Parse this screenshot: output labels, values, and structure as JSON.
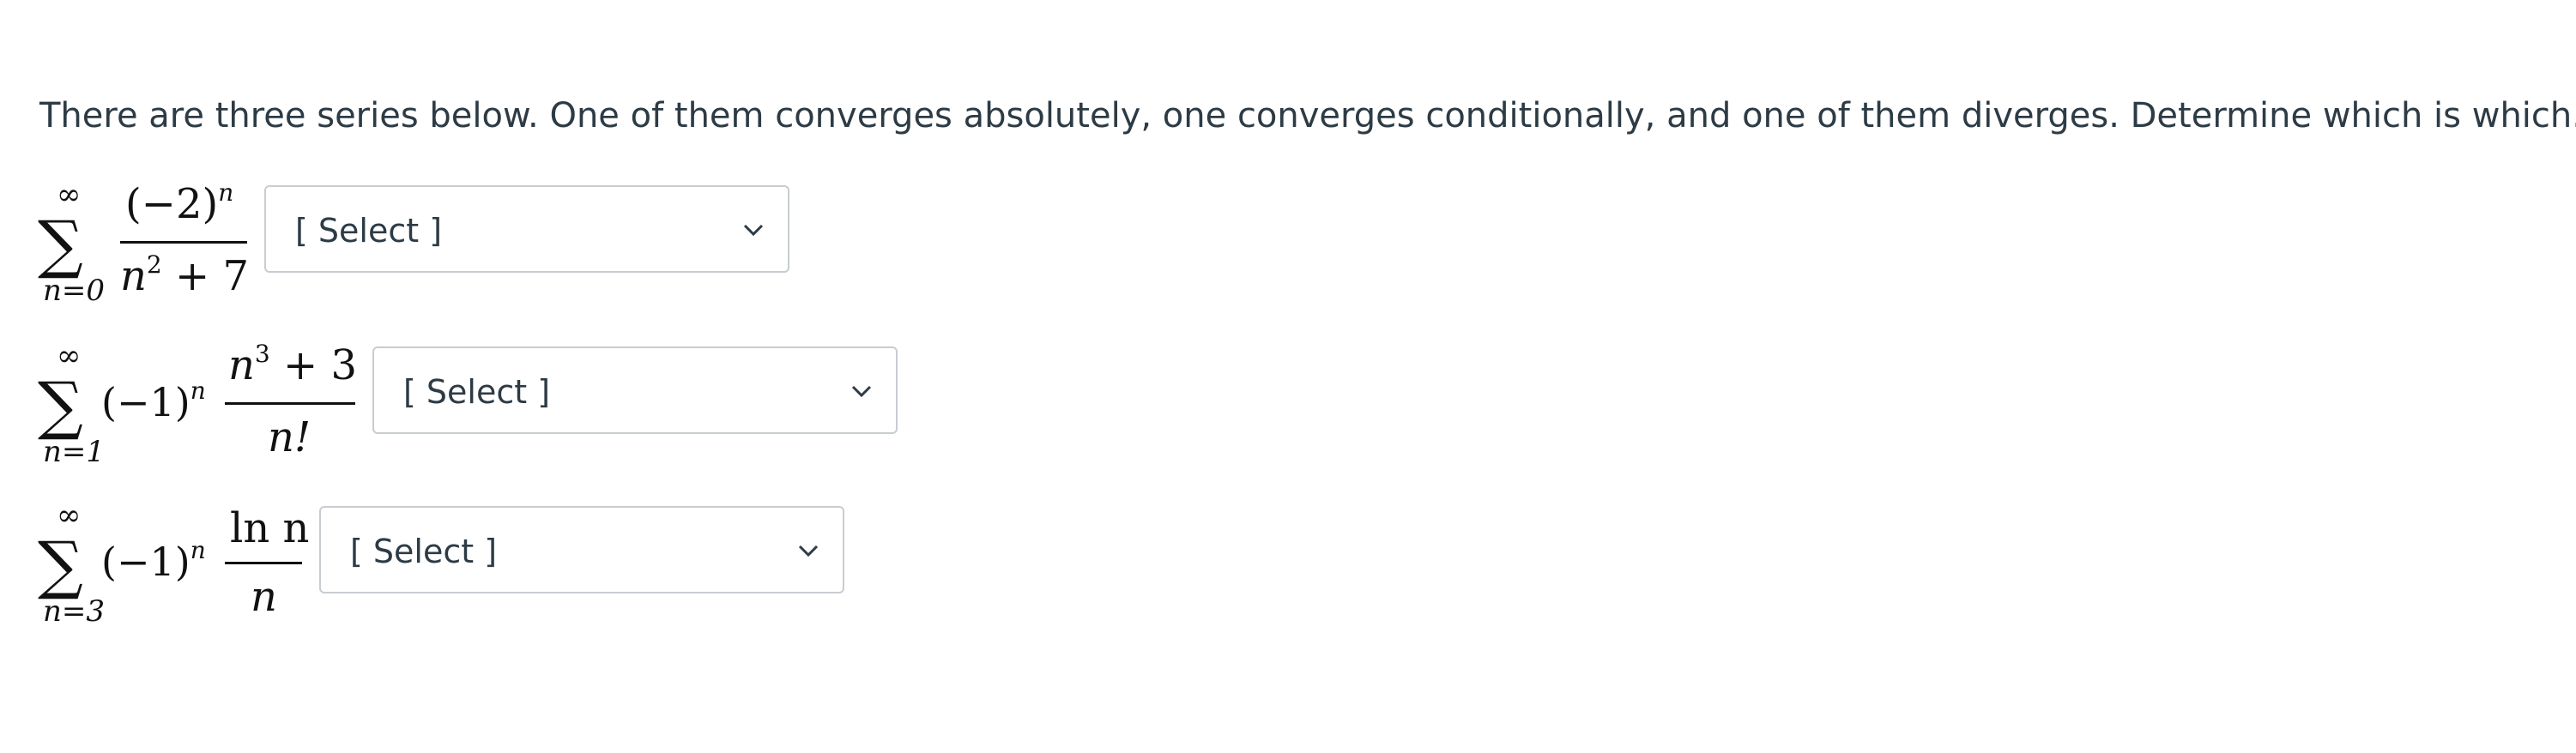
{
  "question": "There are three series below. One of them converges absolutely, one converges conditionally, and one of them diverges. Determine which is which.",
  "series": [
    {
      "upper": "∞",
      "lower": "n=0",
      "prefix_base": "",
      "prefix_exp": "",
      "numerator": "(−2)",
      "numerator_exp": "n",
      "denominator": "n",
      "denominator_exp": "2",
      "denominator_rest": " + 7",
      "select": {
        "value": "[ Select ]"
      }
    },
    {
      "upper": "∞",
      "lower": "n=1",
      "prefix_base": "(−1)",
      "prefix_exp": "n",
      "numerator": "n",
      "numerator_exp": "3",
      "numerator_rest": " + 3",
      "denominator": "n!",
      "select": {
        "value": "[ Select ]"
      }
    },
    {
      "upper": "∞",
      "lower": "n=3",
      "prefix_base": "(−1)",
      "prefix_exp": "n",
      "numerator": "ln n",
      "denominator": "n",
      "select": {
        "value": "[ Select ]"
      }
    }
  ],
  "chevron_icon": "chevron-down-icon"
}
